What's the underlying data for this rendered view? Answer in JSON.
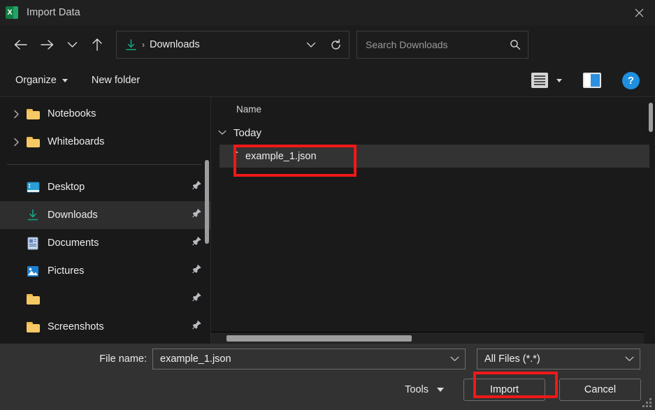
{
  "window": {
    "title": "Import Data",
    "app_icon": "excel-icon",
    "close_label": "✕"
  },
  "nav": {
    "back_icon": "arrow-left-icon",
    "forward_icon": "arrow-right-icon",
    "recent_icon": "chevron-down-icon",
    "up_icon": "arrow-up-icon",
    "address": {
      "location_icon": "downloads-arrow-icon",
      "separator": "›",
      "crumb": "Downloads",
      "dropdown_icon": "chevron-down-icon"
    },
    "refresh_icon": "refresh-icon",
    "search": {
      "placeholder": "Search Downloads",
      "value": "",
      "icon": "search-icon"
    }
  },
  "command_bar": {
    "organize": "Organize",
    "new_folder": "New folder",
    "view_icon": "view-layout-icon",
    "view_caret": "chevron-down-icon",
    "preview_pane_icon": "preview-pane-icon",
    "help_icon": "help-icon",
    "help_glyph": "?"
  },
  "sidebar": {
    "items": [
      {
        "label": "Notebooks",
        "icon": "folder-icon",
        "chevron": true,
        "pinned": false,
        "selected": false
      },
      {
        "label": "Whiteboards",
        "icon": "folder-icon",
        "chevron": true,
        "pinned": false,
        "selected": false
      },
      {
        "label": "Desktop",
        "icon": "desktop-icon",
        "chevron": false,
        "pinned": true,
        "selected": false
      },
      {
        "label": "Downloads",
        "icon": "downloads-icon",
        "chevron": false,
        "pinned": true,
        "selected": true
      },
      {
        "label": "Documents",
        "icon": "documents-icon",
        "chevron": false,
        "pinned": true,
        "selected": false
      },
      {
        "label": "Pictures",
        "icon": "pictures-icon",
        "chevron": false,
        "pinned": true,
        "selected": false
      },
      {
        "label": "",
        "icon": "folder-icon",
        "chevron": false,
        "pinned": true,
        "selected": false
      },
      {
        "label": "Screenshots",
        "icon": "folder-icon",
        "chevron": false,
        "pinned": true,
        "selected": false
      }
    ]
  },
  "file_list": {
    "column_header": "Name",
    "groups": [
      {
        "label": "Today",
        "expanded": true,
        "chevron_icon": "chevron-down-icon",
        "files": [
          {
            "name": "example_1.json",
            "icon": "file-icon",
            "selected": true
          }
        ]
      }
    ]
  },
  "footer": {
    "file_name_label": "File name:",
    "file_name_value": "example_1.json",
    "file_type_value": "All Files (*.*)",
    "file_name_dropdown_icon": "chevron-down-icon",
    "file_type_dropdown_icon": "chevron-down-icon",
    "tools_label": "Tools",
    "tools_caret_icon": "chevron-down-icon",
    "import_label": "Import",
    "cancel_label": "Cancel",
    "resize_grip_icon": "resize-grip-icon"
  },
  "annotations": {
    "highlight_color": "#f01818",
    "targets": [
      "example_1.json",
      "Import"
    ]
  }
}
